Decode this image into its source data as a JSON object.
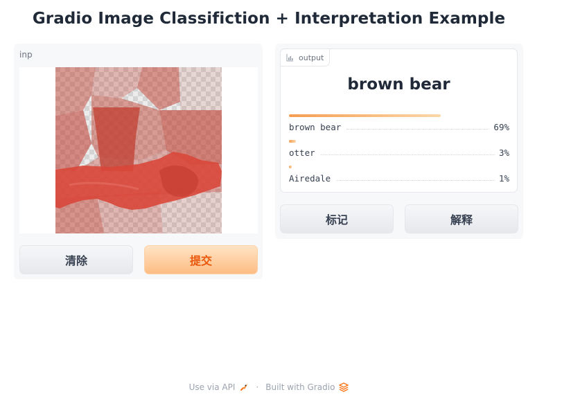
{
  "page": {
    "title": "Gradio Image Classifiction + Interpretation Example"
  },
  "input": {
    "label": "inp",
    "clear_label": "清除",
    "submit_label": "提交"
  },
  "output": {
    "tab_label": "output",
    "top_label": "brown bear",
    "confidences": [
      {
        "label": "brown bear",
        "percent": "69%",
        "value": 0.69
      },
      {
        "label": "otter",
        "percent": "3%",
        "value": 0.03
      },
      {
        "label": "Airedale",
        "percent": "1%",
        "value": 0.01
      }
    ],
    "flag_label": "标记",
    "interpret_label": "解释"
  },
  "footer": {
    "api_label": "Use via API",
    "separator": "·",
    "built_label": "Built with Gradio"
  },
  "colors": {
    "primary_text": "#ea580c",
    "bar_start": "#f59e52",
    "bar_end": "#fbd7a8",
    "heat_strong": "#d9473a"
  }
}
